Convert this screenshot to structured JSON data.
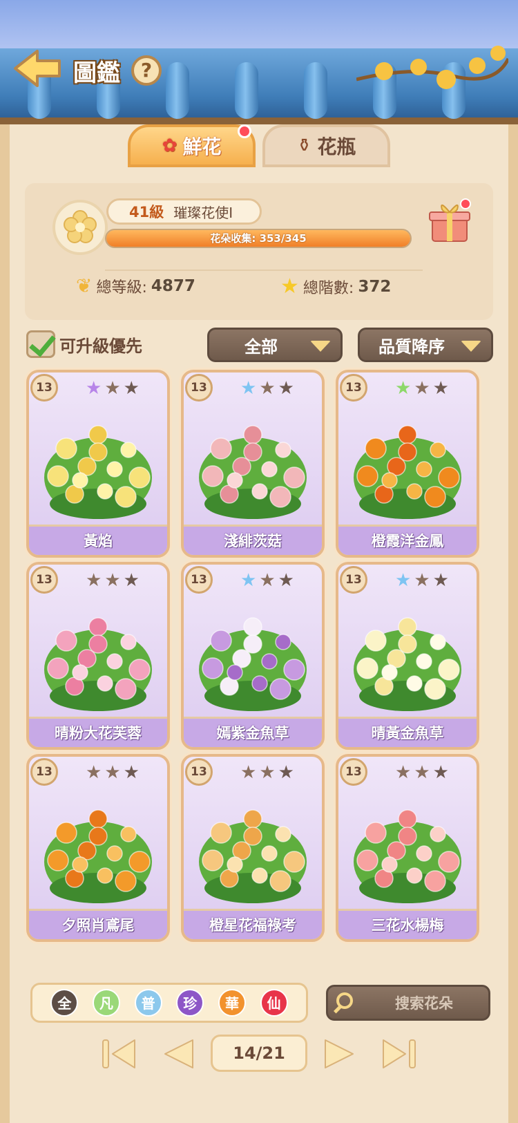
{
  "header": {
    "title": "圖鑑",
    "help_glyph": "?"
  },
  "tabs": [
    {
      "label": "鮮花",
      "icon": "rose-icon",
      "active": true,
      "has_dot": true
    },
    {
      "label": "花瓶",
      "icon": "vase-icon",
      "active": false,
      "has_dot": false
    }
  ],
  "profile": {
    "level": "41級",
    "rank": "璀璨花使I",
    "progress_text": "花朵收集: 353/345",
    "progress_fraction": 1.0,
    "total_level_label": "總等級:",
    "total_level_value": "4877",
    "total_tier_label": "總階數:",
    "total_tier_value": "372"
  },
  "filters": {
    "upgradable_first_label": "可升級優先",
    "upgradable_first_checked": true,
    "category_label": "全部",
    "sort_label": "品質降序"
  },
  "cards": [
    {
      "level": "13",
      "name": "黃焰",
      "star1": "#b784e8",
      "colors": [
        "#f7e27a",
        "#f0c94a",
        "#fff3a8"
      ]
    },
    {
      "level": "13",
      "name": "淺緋茨菇",
      "star1": "#7ec4f2",
      "colors": [
        "#f2b7b9",
        "#e68f98",
        "#fad7d6"
      ]
    },
    {
      "level": "13",
      "name": "橙霞洋金鳳",
      "star1": "#8dd86a",
      "colors": [
        "#f08a1e",
        "#e8661a",
        "#f6b545"
      ]
    },
    {
      "level": "13",
      "name": "晴粉大花芙蓉",
      "star1": "#8a7060",
      "colors": [
        "#f3a3bd",
        "#ec7fa1",
        "#fbd2df"
      ]
    },
    {
      "level": "13",
      "name": "嫣紫金魚草",
      "star1": "#7ec4f2",
      "colors": [
        "#c79ae0",
        "#f6eef8",
        "#a66cc9"
      ]
    },
    {
      "level": "13",
      "name": "晴黃金魚草",
      "star1": "#7ec4f2",
      "colors": [
        "#fbf4c8",
        "#f7e59a",
        "#fffbe6"
      ]
    },
    {
      "level": "13",
      "name": "夕照肖鳶尾",
      "star1": "#8a7060",
      "colors": [
        "#f39a2a",
        "#e8781a",
        "#f8c060"
      ]
    },
    {
      "level": "13",
      "name": "橙星花福祿考",
      "star1": "#8a7060",
      "colors": [
        "#f6c77e",
        "#eea64a",
        "#fbe2b0"
      ]
    },
    {
      "level": "13",
      "name": "三花水楊梅",
      "star1": "#8a7060",
      "colors": [
        "#f7a2a0",
        "#f08585",
        "#fcd0c8"
      ]
    }
  ],
  "rarity_filters": [
    {
      "label": "全",
      "color": "#5c4d45"
    },
    {
      "label": "凡",
      "color": "#9ad878"
    },
    {
      "label": "普",
      "color": "#8cc8ec"
    },
    {
      "label": "珍",
      "color": "#8d56c7"
    },
    {
      "label": "華",
      "color": "#f2922e"
    },
    {
      "label": "仙",
      "color": "#e8344a"
    }
  ],
  "search": {
    "placeholder": "搜索花朵"
  },
  "pagination": {
    "label": "14/21"
  }
}
